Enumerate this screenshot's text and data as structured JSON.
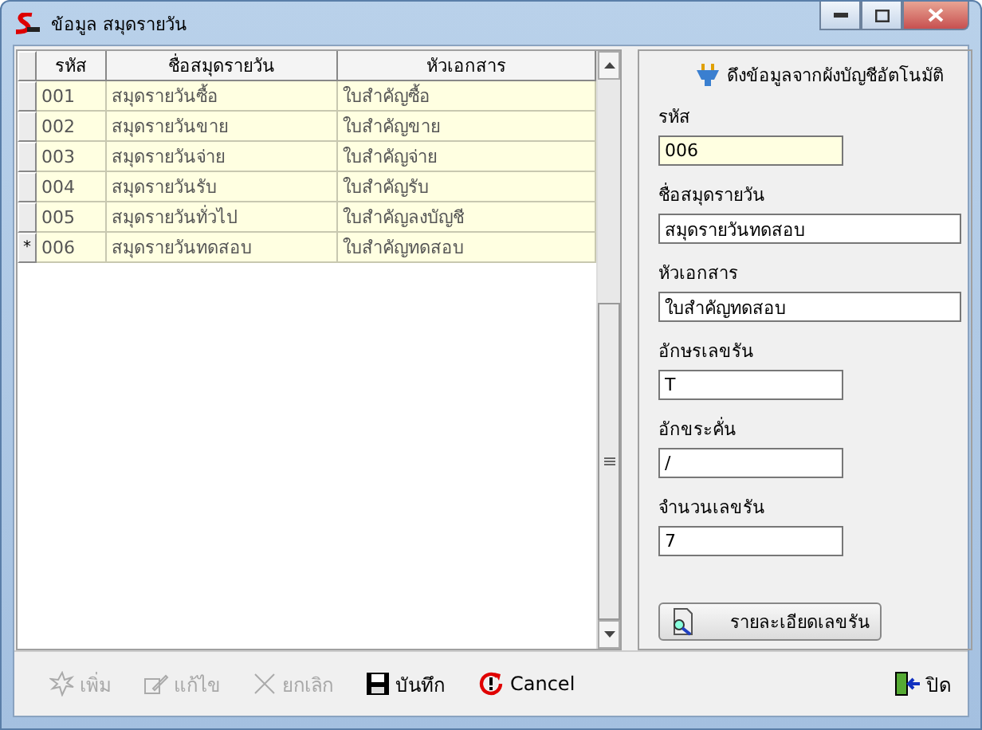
{
  "window": {
    "title": "ข้อมูล สมุดรายวัน"
  },
  "table": {
    "columns": [
      "รหัส",
      "ชื่อสมุดรายวัน",
      "หัวเอกสาร"
    ],
    "current_marker": "*",
    "rows": [
      {
        "cells": [
          "001",
          "สมุดรายวันซื้อ",
          "ใบสำคัญซื้อ"
        ],
        "current": false
      },
      {
        "cells": [
          "002",
          "สมุดรายวันขาย",
          "ใบสำคัญขาย"
        ],
        "current": false
      },
      {
        "cells": [
          "003",
          "สมุดรายวันจ่าย",
          "ใบสำคัญจ่าย"
        ],
        "current": false
      },
      {
        "cells": [
          "004",
          "สมุดรายวันรับ",
          "ใบสำคัญรับ"
        ],
        "current": false
      },
      {
        "cells": [
          "005",
          "สมุดรายวันทั่วไป",
          "ใบสำคัญลงบัญชี"
        ],
        "current": false
      },
      {
        "cells": [
          "006",
          "สมุดรายวันทดสอบ",
          "ใบสำคัญทดสอบ"
        ],
        "current": true
      }
    ]
  },
  "form": {
    "import_link": "ดึงข้อมูลจากผังบัญชีอัตโนมัติ",
    "fields": [
      {
        "kind": "code",
        "label": "รหัส",
        "value": "006",
        "highlighted": true
      },
      {
        "kind": "name",
        "label": "ชื่อสมุดรายวัน",
        "value": "สมุดรายวันทดสอบ",
        "highlighted": false
      },
      {
        "kind": "header",
        "label": "หัวเอกสาร",
        "value": "ใบสำคัญทดสอบ",
        "highlighted": false
      },
      {
        "kind": "prefix",
        "label": "อักษรเลขรัน",
        "value": "T",
        "highlighted": false
      },
      {
        "kind": "separator",
        "label": "อักขระคั่น",
        "value": "/",
        "highlighted": false
      },
      {
        "kind": "digits",
        "label": "จำนวนเลขรัน",
        "value": "7",
        "highlighted": false
      }
    ],
    "detail_button": "รายละเอียดเลขรัน"
  },
  "toolbar": [
    {
      "kind": "add",
      "label": "เพิ่ม",
      "disabled": true
    },
    {
      "kind": "edit",
      "label": "แก้ไข",
      "disabled": true
    },
    {
      "kind": "cancel-x",
      "label": "ยกเลิก",
      "disabled": true
    },
    {
      "kind": "save",
      "label": "บันทึก",
      "disabled": false
    },
    {
      "kind": "undo",
      "label": "Cancel",
      "disabled": false
    }
  ],
  "close_button": "ปิด"
}
